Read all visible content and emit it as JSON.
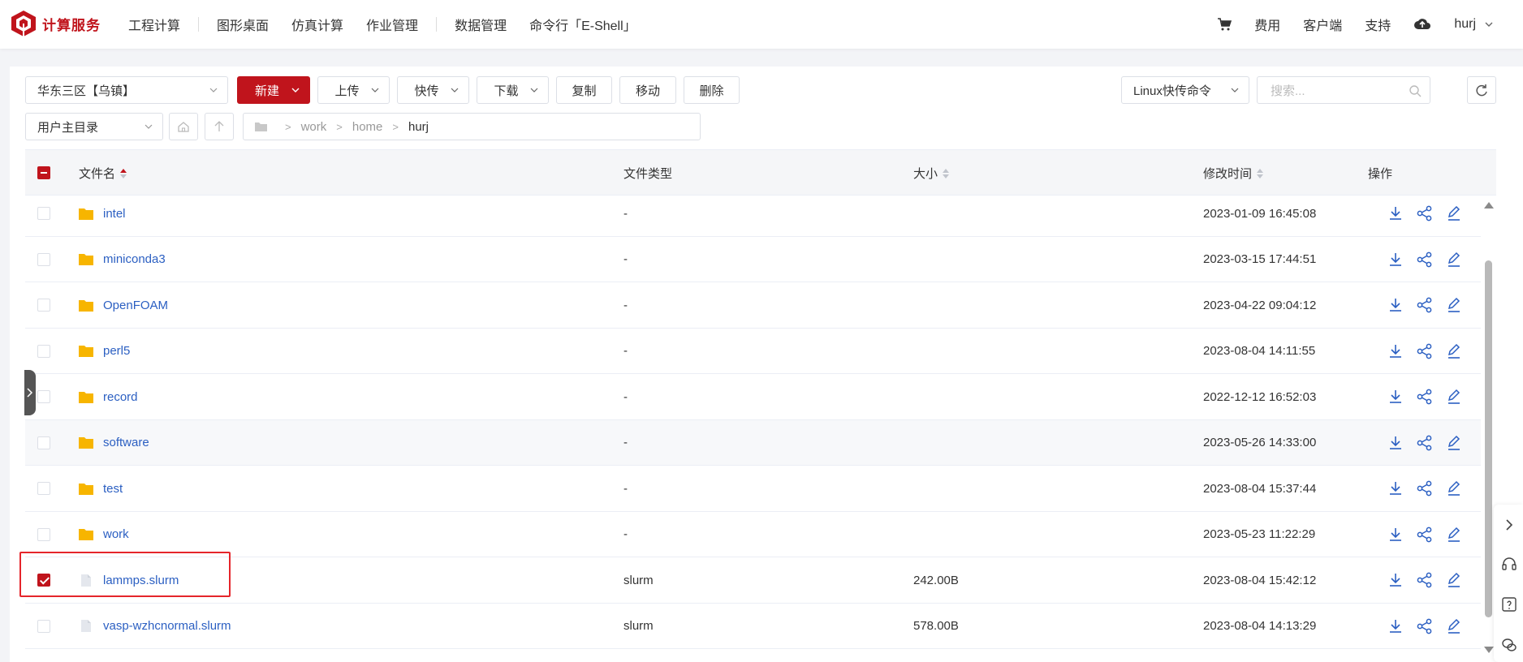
{
  "brand": {
    "name": "计算服务",
    "color": "#c0141c"
  },
  "nav": {
    "items": [
      "工程计算",
      "图形桌面",
      "仿真计算",
      "作业管理",
      "数据管理",
      "命令行「E-Shell」"
    ]
  },
  "right_nav": {
    "cart_icon": "cart-icon",
    "fees": "费用",
    "client": "客户端",
    "support": "支持",
    "cloud_icon": "cloud-icon",
    "user": "hurj"
  },
  "toolbar": {
    "region": "华东三区【乌镇】",
    "new": "新建",
    "upload": "上传",
    "fast_transfer": "快传",
    "download": "下载",
    "copy": "复制",
    "move": "移动",
    "delete": "删除",
    "linux_cmd": "Linux快传命令",
    "search_placeholder": "搜索...",
    "home_dir": "用户主目录"
  },
  "breadcrumb": [
    "work",
    "home",
    "hurj"
  ],
  "table": {
    "headers": {
      "name": "文件名",
      "type": "文件类型",
      "size": "大小",
      "mtime": "修改时间",
      "ops": "操作"
    },
    "rows": [
      {
        "name": "intel",
        "kind": "folder",
        "type": "-",
        "size": "",
        "mtime": "2023-01-09 16:45:08",
        "checked": false
      },
      {
        "name": "miniconda3",
        "kind": "folder",
        "type": "-",
        "size": "",
        "mtime": "2023-03-15 17:44:51",
        "checked": false
      },
      {
        "name": "OpenFOAM",
        "kind": "folder",
        "type": "-",
        "size": "",
        "mtime": "2023-04-22 09:04:12",
        "checked": false
      },
      {
        "name": "perl5",
        "kind": "folder",
        "type": "-",
        "size": "",
        "mtime": "2023-08-04 14:11:55",
        "checked": false
      },
      {
        "name": "record",
        "kind": "folder",
        "type": "-",
        "size": "",
        "mtime": "2022-12-12 16:52:03",
        "checked": false
      },
      {
        "name": "software",
        "kind": "folder",
        "type": "-",
        "size": "",
        "mtime": "2023-05-26 14:33:00",
        "checked": false
      },
      {
        "name": "test",
        "kind": "folder",
        "type": "-",
        "size": "",
        "mtime": "2023-08-04 15:37:44",
        "checked": false
      },
      {
        "name": "work",
        "kind": "folder",
        "type": "-",
        "size": "",
        "mtime": "2023-05-23 11:22:29",
        "checked": false
      },
      {
        "name": "lammps.slurm",
        "kind": "file",
        "type": "slurm",
        "size": "242.00B",
        "mtime": "2023-08-04 15:42:12",
        "checked": true
      },
      {
        "name": "vasp-wzhcnormal.slurm",
        "kind": "file",
        "type": "slurm",
        "size": "578.00B",
        "mtime": "2023-08-04 14:13:29",
        "checked": false
      }
    ]
  },
  "colors": {
    "accent": "#c0141c",
    "link": "#2b5fc2",
    "folder": "#f7b500",
    "highlight_border": "#e5252b"
  }
}
